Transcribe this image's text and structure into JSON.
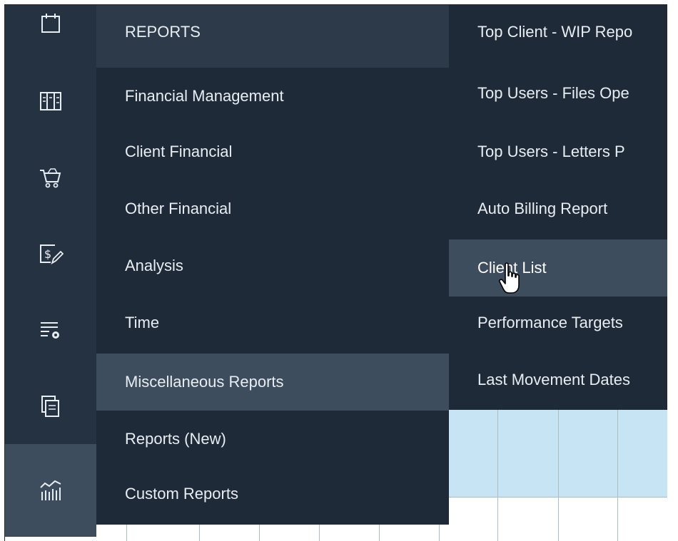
{
  "rail": {
    "icons": [
      {
        "name": "calendar-icon"
      },
      {
        "name": "ledger-icon"
      },
      {
        "name": "cart-icon"
      },
      {
        "name": "dollar-edit-icon"
      },
      {
        "name": "list-settings-icon"
      },
      {
        "name": "documents-icon"
      },
      {
        "name": "chart-icon"
      }
    ],
    "active_index": 6
  },
  "menu": {
    "header": "REPORTS",
    "items": [
      {
        "label": "Financial Management"
      },
      {
        "label": "Client Financial"
      },
      {
        "label": "Other Financial"
      },
      {
        "label": "Analysis"
      },
      {
        "label": "Time"
      },
      {
        "label": "Miscellaneous Reports"
      },
      {
        "label": "Reports (New)"
      },
      {
        "label": "Custom Reports"
      }
    ],
    "active_label": "Miscellaneous Reports"
  },
  "submenu": {
    "items": [
      {
        "label": "Top Client - WIP Repo"
      },
      {
        "label": "Top Users - Files Ope"
      },
      {
        "label": "Top Users - Letters P"
      },
      {
        "label": "Auto Billing Report"
      },
      {
        "label": "Client List"
      },
      {
        "label": "Performance Targets"
      },
      {
        "label": "Last Movement Dates"
      }
    ],
    "hovered_label": "Client List"
  },
  "colors": {
    "menu_bg": "#1e2a38",
    "menu_active": "#3d4d5d",
    "text": "#e8edf2",
    "grid_blue": "#c6e4f3"
  }
}
